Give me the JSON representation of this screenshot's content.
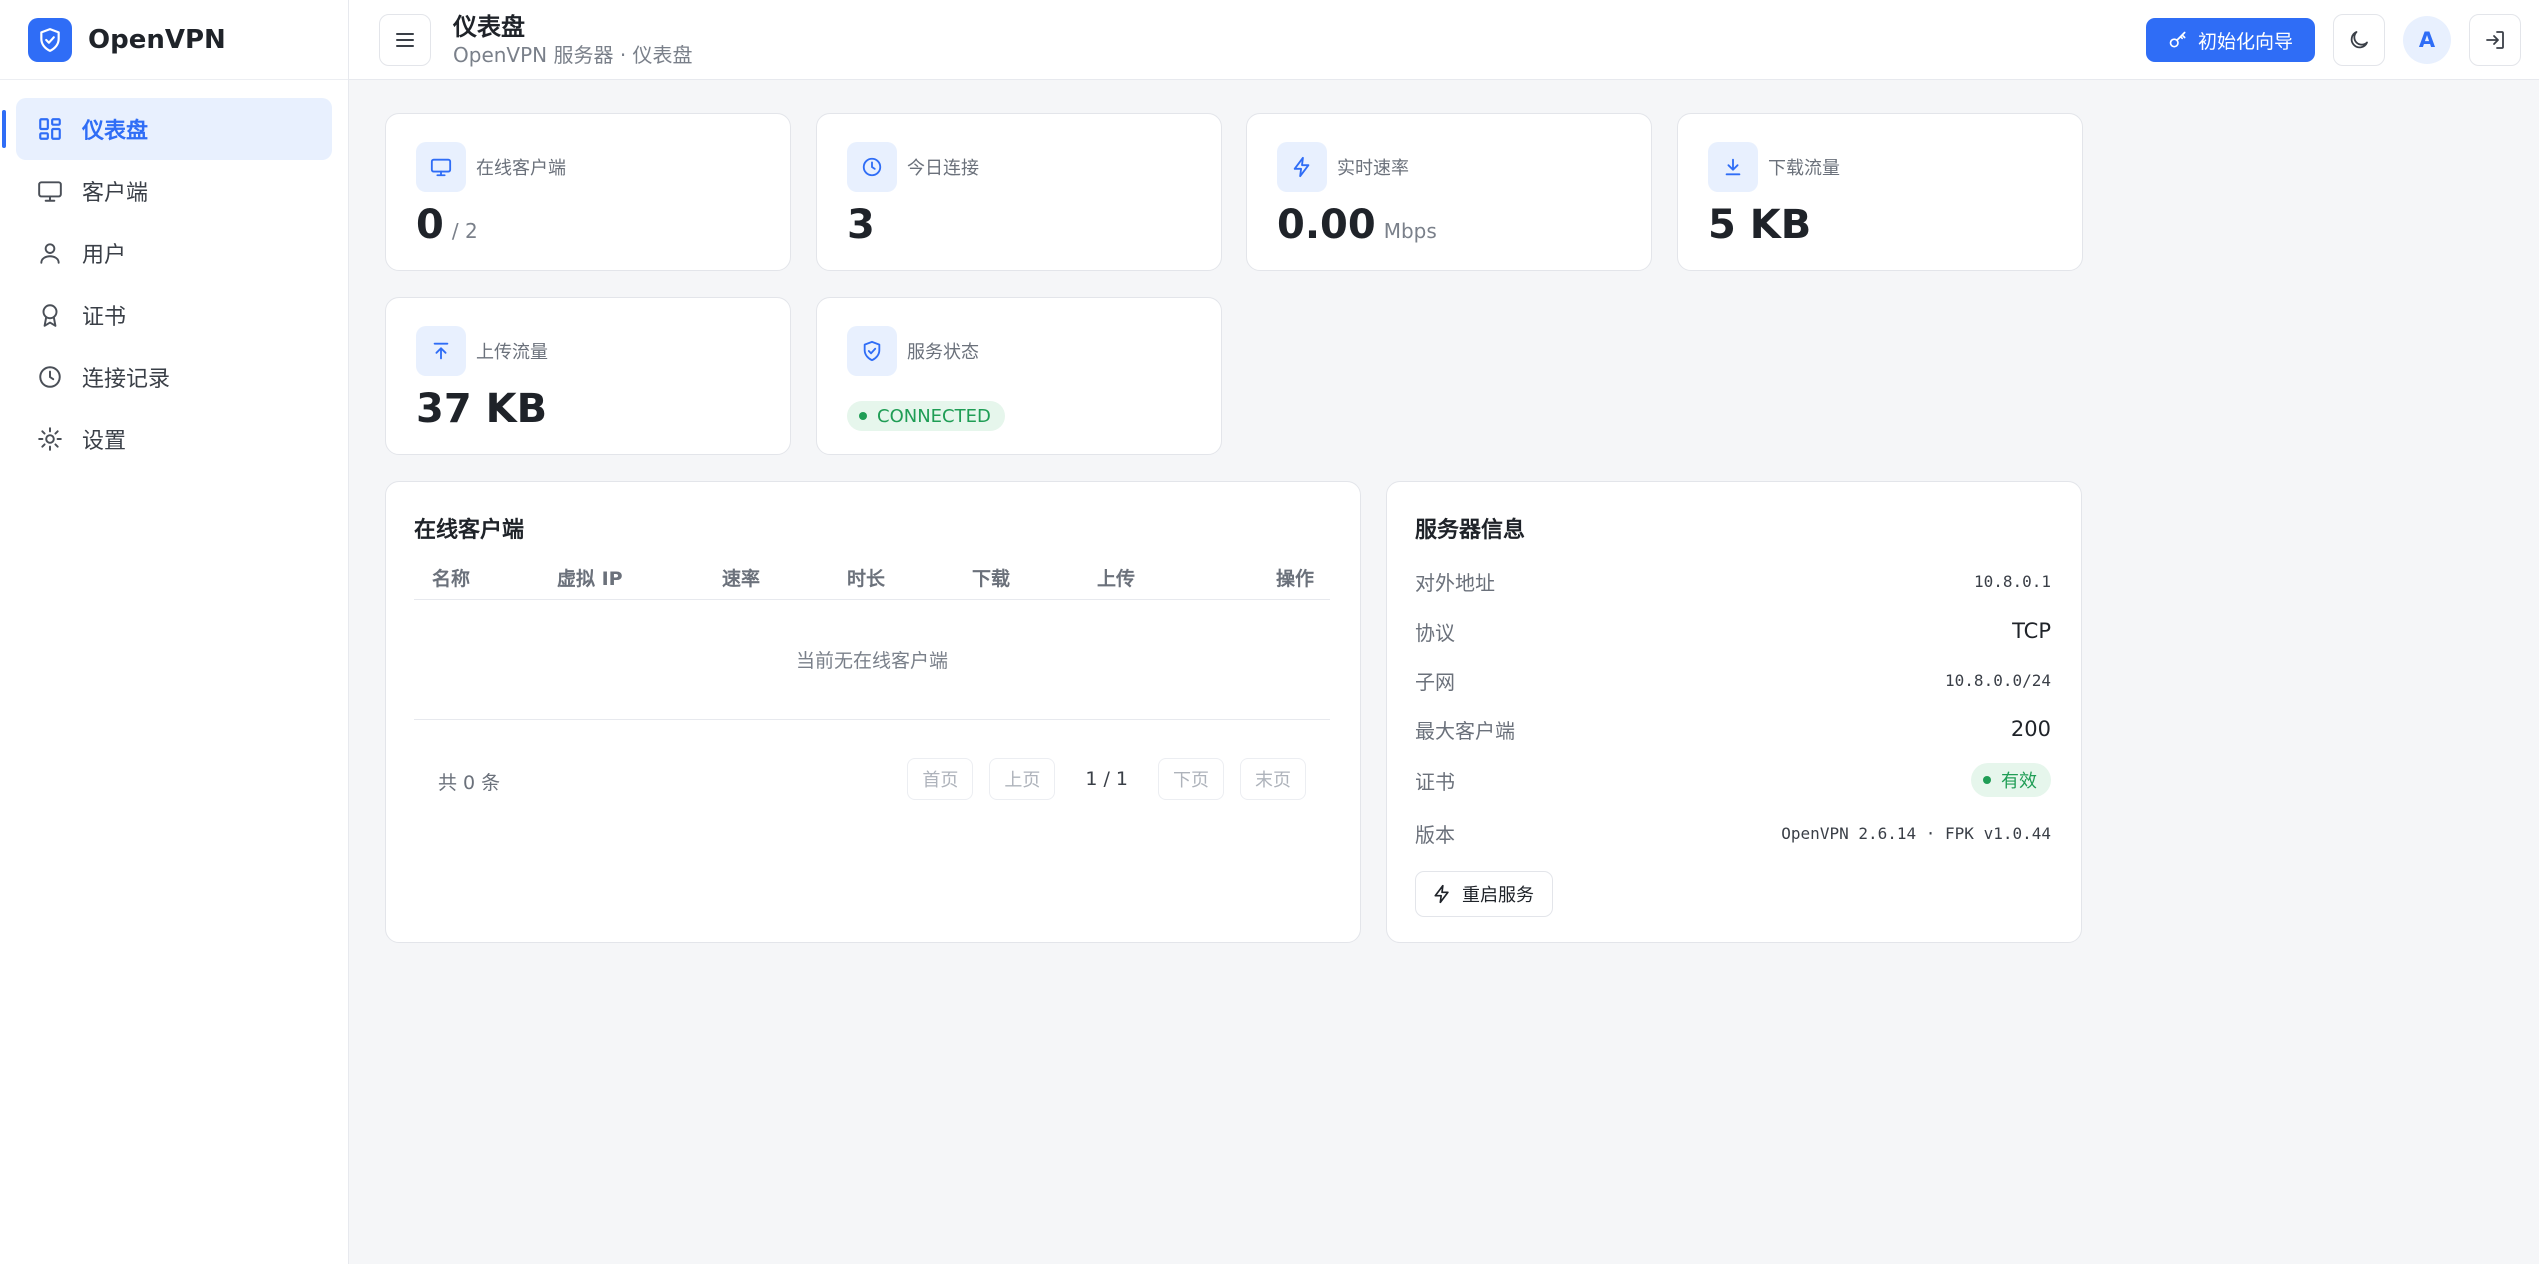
{
  "brand": {
    "name": "OpenVPN",
    "logo_icon": "shield-check-icon",
    "color": "#2f6df6"
  },
  "sidebar": {
    "items": [
      {
        "label": "仪表盘",
        "icon": "dashboard-icon",
        "active": true
      },
      {
        "label": "客户端",
        "icon": "monitor-icon",
        "active": false
      },
      {
        "label": "用户",
        "icon": "user-icon",
        "active": false
      },
      {
        "label": "证书",
        "icon": "award-icon",
        "active": false
      },
      {
        "label": "连接记录",
        "icon": "clock-icon",
        "active": false
      },
      {
        "label": "设置",
        "icon": "gear-icon",
        "active": false
      }
    ]
  },
  "header": {
    "title": "仪表盘",
    "subtitle": "OpenVPN 服务器 · 仪表盘",
    "wizard_label": "初始化向导",
    "avatar_letter": "A"
  },
  "stats": {
    "online_clients": {
      "label": "在线客户端",
      "value": "0",
      "unit": "/ 2"
    },
    "today_connections": {
      "label": "今日连接",
      "value": "3"
    },
    "realtime_rate": {
      "label": "实时速率",
      "value": "0.00",
      "unit": "Mbps"
    },
    "download": {
      "label": "下载流量",
      "value": "5 KB"
    },
    "upload": {
      "label": "上传流量",
      "value": "37 KB"
    },
    "service_status": {
      "label": "服务状态",
      "value": "CONNECTED"
    }
  },
  "clients_panel": {
    "title": "在线客户端",
    "columns": [
      "名称",
      "虚拟 IP",
      "速率",
      "时长",
      "下载",
      "上传",
      "操作"
    ],
    "empty_text": "当前无在线客户端",
    "total": "共 0 条",
    "pager": {
      "first": "首页",
      "prev": "上页",
      "info": "1 / 1",
      "next": "下页",
      "last": "末页"
    }
  },
  "server_panel": {
    "title": "服务器信息",
    "rows": [
      {
        "label": "对外地址",
        "value": "10.8.0.1"
      },
      {
        "label": "协议",
        "value": "TCP"
      },
      {
        "label": "子网",
        "value": "10.8.0.0/24"
      },
      {
        "label": "最大客户端",
        "value": "200"
      },
      {
        "label": "证书",
        "value": "有效"
      },
      {
        "label": "版本",
        "value": "OpenVPN 2.6.14 · FPK v1.0.44"
      }
    ],
    "restart_label": "重启服务"
  },
  "colors": {
    "accent": "#2f6df6",
    "success": "#1f9d55",
    "success_bg": "#e6f6ec",
    "icon_bg": "#e8f0fe"
  }
}
